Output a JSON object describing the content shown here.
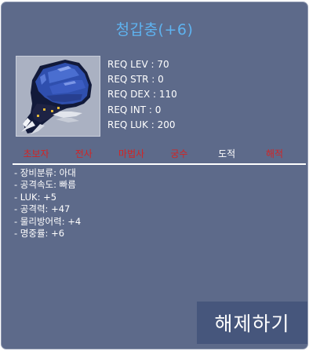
{
  "item": {
    "name": "청갑충(+6)",
    "icon": "blue-beetle-claw-icon",
    "colors": {
      "name": "#5eb3f0",
      "panel": "#5d6a8a",
      "disallowed_job": "#d32424",
      "allowed_job": "#ffffff",
      "button": "#46567c"
    }
  },
  "requirements": [
    "REQ LEV : 70",
    "REQ STR : 0",
    "REQ DEX : 110",
    "REQ INT : 0",
    "REQ LUK : 200"
  ],
  "jobs": [
    {
      "label": "초보자",
      "allowed": false
    },
    {
      "label": "전사",
      "allowed": false
    },
    {
      "label": "마법사",
      "allowed": false
    },
    {
      "label": "궁수",
      "allowed": false
    },
    {
      "label": "도적",
      "allowed": true
    },
    {
      "label": "해적",
      "allowed": false
    }
  ],
  "stats": [
    "- 장비분류: 아대",
    "- 공격속도: 빠름",
    "- LUK: +5",
    "- 공격력: +47",
    "- 물리방어력: +4",
    "- 명중률: +6"
  ],
  "actions": {
    "unequip_label": "해제하기"
  }
}
